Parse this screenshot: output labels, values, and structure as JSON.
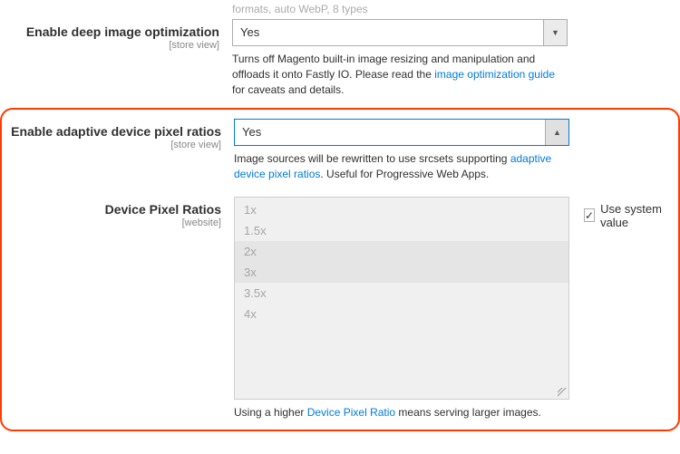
{
  "row0": {
    "truncated_text": "formats, auto WebP, 8 types"
  },
  "row1": {
    "label": "Enable deep image optimization",
    "scope": "[store view]",
    "select_value": "Yes",
    "note_pre": "Turns off Magento built-in image resizing and manipulation and offloads it onto Fastly IO. Please read the ",
    "note_link": "image optimization guide",
    "note_post": " for caveats and details."
  },
  "row2": {
    "label": "Enable adaptive device pixel ratios",
    "scope": "[store view]",
    "select_value": "Yes",
    "note_pre": "Image sources will be rewritten to use srcsets supporting ",
    "note_link": "adaptive device pixel ratios",
    "note_post": ". Useful for Progressive Web Apps."
  },
  "row3": {
    "label": "Device Pixel Ratios",
    "scope": "[website]",
    "options": [
      "1x",
      "1.5x",
      "2x",
      "3x",
      "3.5x",
      "4x"
    ],
    "use_system_label": "Use system value",
    "note_pre": "Using a higher ",
    "note_link": "Device Pixel Ratio",
    "note_post": " means serving larger images."
  }
}
